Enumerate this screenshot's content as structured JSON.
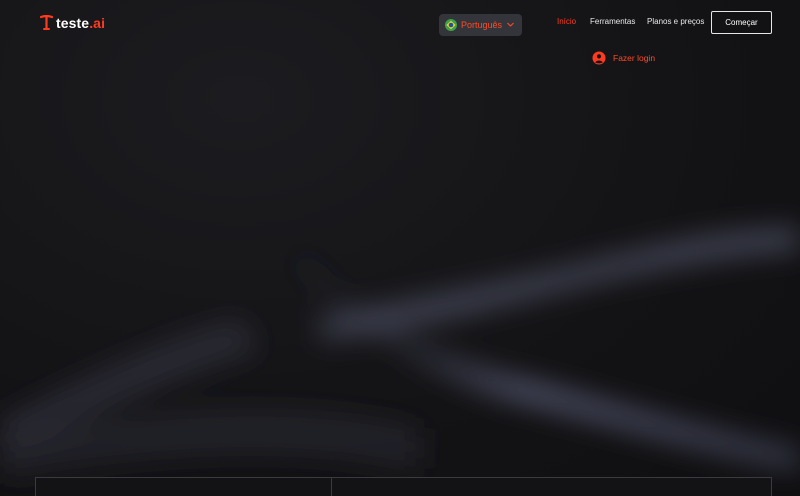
{
  "brand": {
    "name": "teste",
    "suffix": ".ai",
    "accent": "#ff3b1f"
  },
  "language": {
    "label": "Português",
    "flag": "brazil-flag",
    "icon": "chevron-down-icon"
  },
  "nav": {
    "items": [
      {
        "label": "Início",
        "active": true
      },
      {
        "label": "Ferramentas",
        "active": false
      },
      {
        "label": "Planos e preços",
        "active": false
      }
    ],
    "cta_label": "Começar"
  },
  "login": {
    "label": "Fazer login",
    "icon": "user-avatar-icon"
  }
}
